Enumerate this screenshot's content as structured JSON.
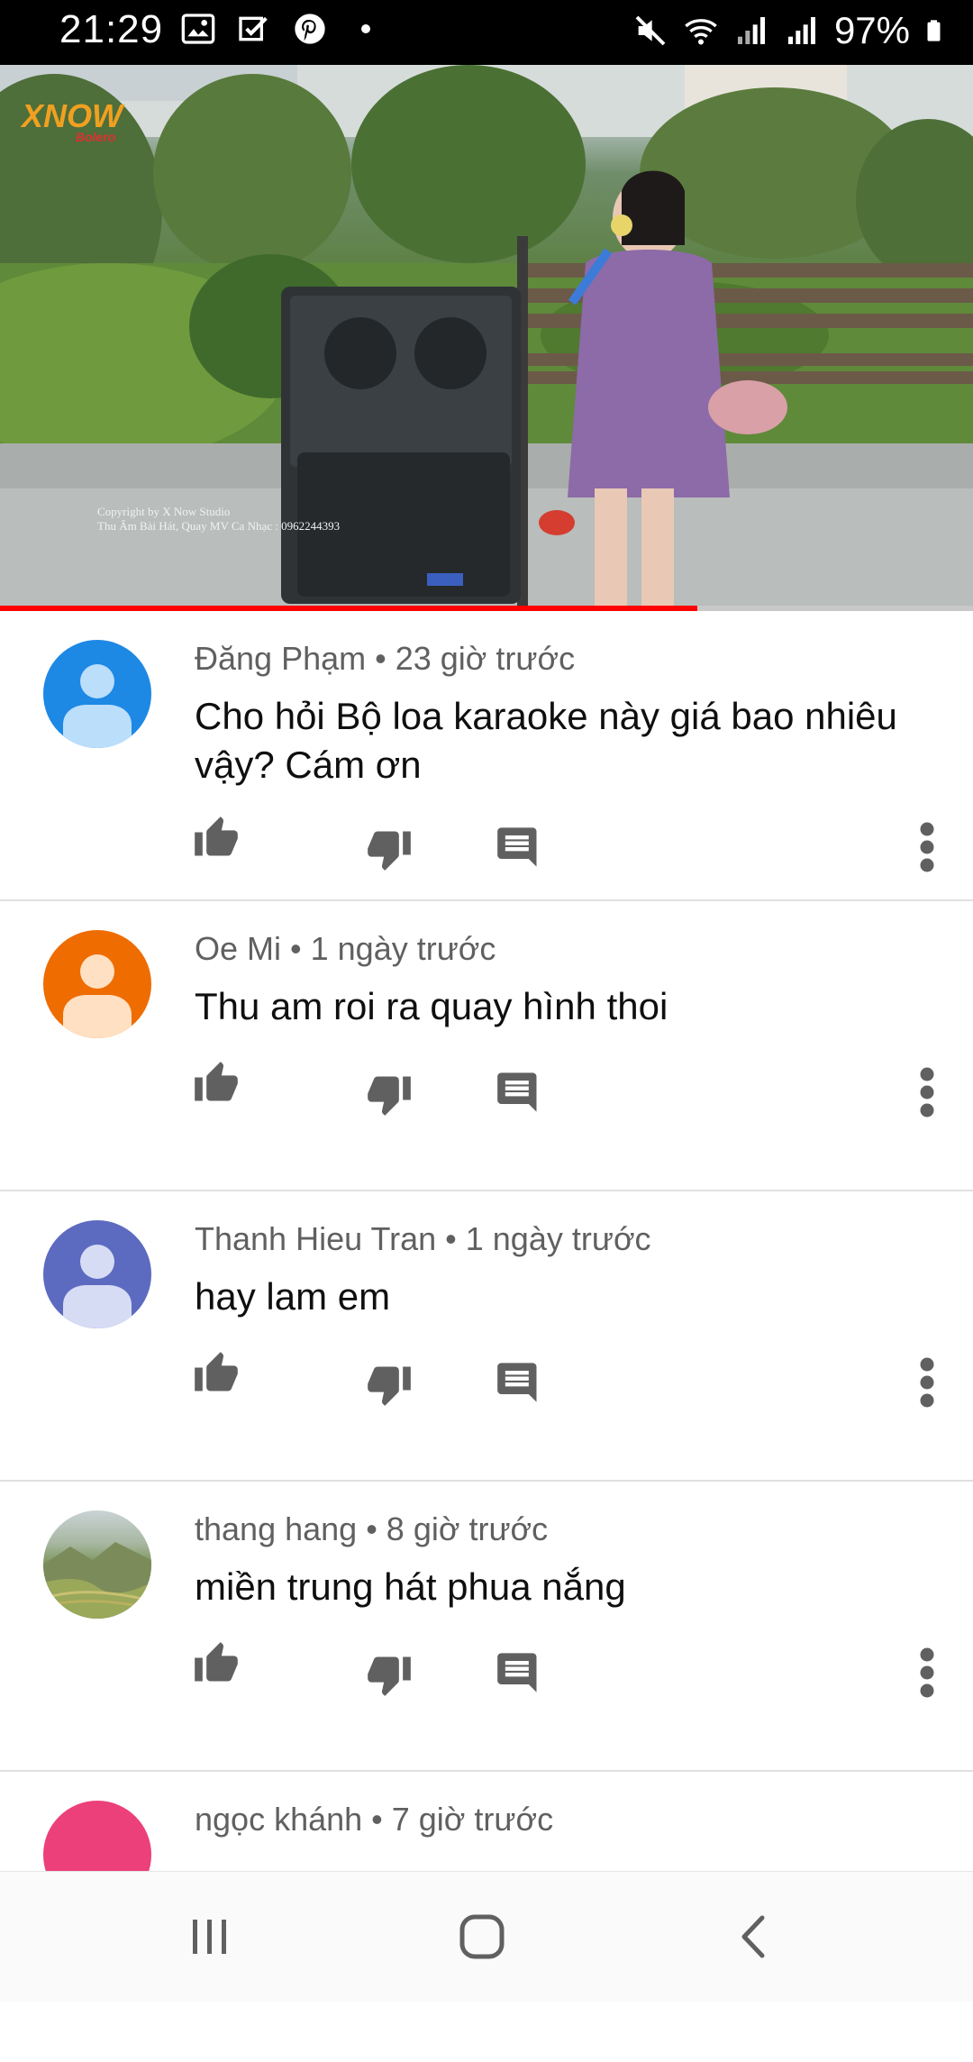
{
  "status_bar": {
    "time": "21:29",
    "battery": "97%",
    "left_icons": [
      "image-icon",
      "tasks-icon",
      "pinterest-icon",
      "dot-icon"
    ],
    "right_icons": [
      "mute-icon",
      "wifi-icon",
      "signal-icon",
      "signal-icon",
      "battery-icon"
    ]
  },
  "video": {
    "channel_logo": "XNOW",
    "channel_logo_sub": "Bolero",
    "watermark_line1": "Copyright by X Now Studio",
    "watermark_line2": "Thu Âm Bài Hát, Quay MV Ca Nhạc : 0962244393",
    "progress_fraction": 0.717,
    "accent": "#ff0000"
  },
  "comments": [
    {
      "author": "Đăng Phạm",
      "time": "23 giờ trước",
      "text": "Cho hỏi Bộ loa karaoke này giá bao nhiêu vậy? Cám ơn",
      "avatar_color": "#1e88e5",
      "avatar_fg": "#bbdefb"
    },
    {
      "author": "Oe Mi",
      "time": "1 ngày trước",
      "text": "Thu am roi ra quay hình thoi",
      "avatar_color": "#ef6c00",
      "avatar_fg": "#ffe0c2"
    },
    {
      "author": "Thanh Hieu Tran",
      "time": "1 ngày trước",
      "text": "hay lam em",
      "avatar_color": "#5c6bc0",
      "avatar_fg": "#d7dcf5"
    },
    {
      "author": "thang hang",
      "time": "8 giờ trước",
      "text": "miền trung hát phua nắng",
      "avatar_color": "#7d8f5a",
      "avatar_fg": ""
    },
    {
      "author": "ngọc khánh",
      "time": "7 giờ trước",
      "text": "",
      "avatar_color": "#ec407a",
      "avatar_fg": ""
    }
  ],
  "nav_bar": {
    "buttons": [
      "recents-icon",
      "home-icon",
      "back-icon"
    ]
  }
}
